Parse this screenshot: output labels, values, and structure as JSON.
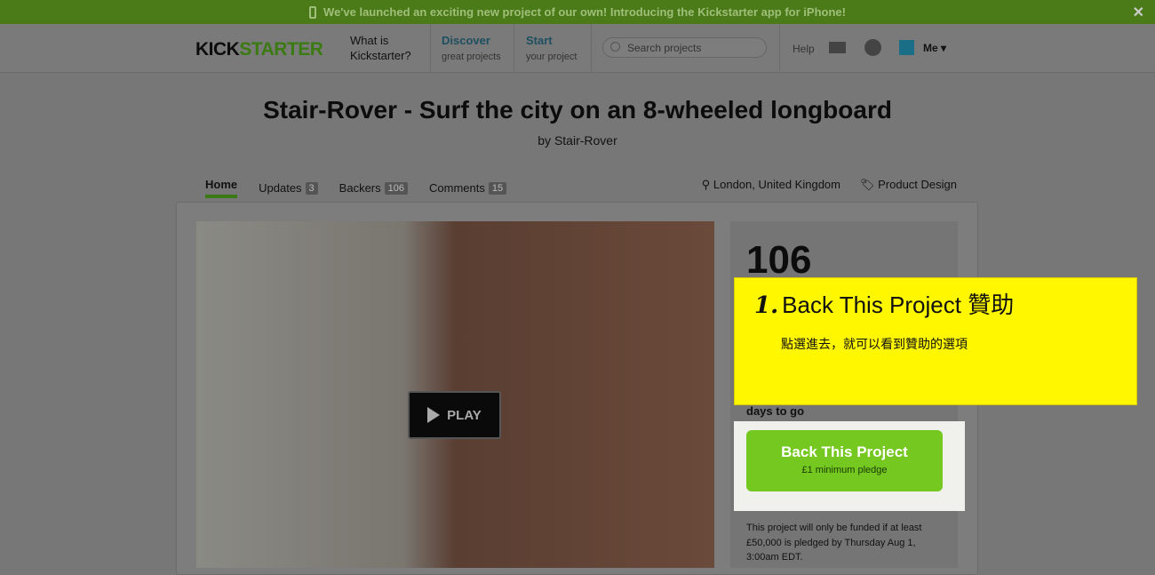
{
  "banner": {
    "text": "We've launched an exciting new project of our own! Introducing the Kickstarter app for iPhone!",
    "close": "✕"
  },
  "nav": {
    "logo_a": "KICK",
    "logo_b": "STARTER",
    "what_1": "What is",
    "what_2": "Kickstarter?",
    "discover": "Discover",
    "discover_sub": "great projects",
    "start": "Start",
    "start_sub": "your project",
    "search_placeholder": "Search projects",
    "help": "Help",
    "me": "Me ▾"
  },
  "project": {
    "title": "Stair-Rover - Surf the city on an 8-wheeled longboard",
    "byline": "by Stair-Rover",
    "location": "London, United Kingdom",
    "category": "Product Design"
  },
  "tabs": [
    {
      "label": "Home"
    },
    {
      "label": "Updates",
      "count": "3"
    },
    {
      "label": "Backers",
      "count": "106"
    },
    {
      "label": "Comments",
      "count": "15"
    }
  ],
  "video": {
    "play": "PLAY"
  },
  "stats": {
    "backers": "106",
    "days_label": "days to go"
  },
  "back_button": {
    "label": "Back This Project",
    "sub": "£1 minimum pledge"
  },
  "funding_note": "This project will only be funded if at least £50,000 is pledged by Thursday Aug 1, 3:00am EDT.",
  "tooltip": {
    "step": "1.",
    "title": "Back This Project 贊助",
    "body": "點選進去，就可以看到贊助的選項"
  }
}
